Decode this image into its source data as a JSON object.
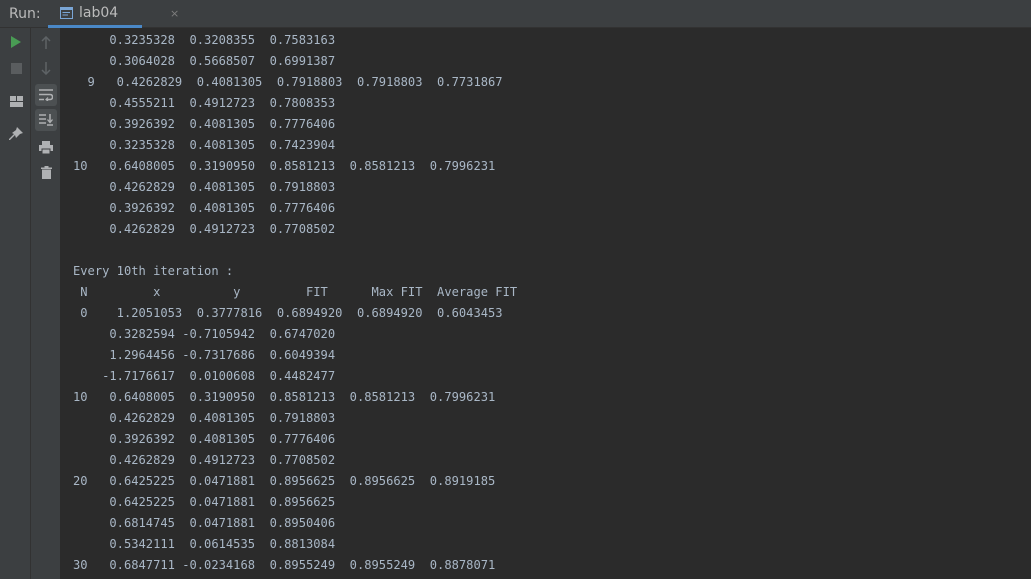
{
  "header": {
    "run_label": "Run:",
    "tab": {
      "label": "lab04",
      "icon": "console-icon",
      "close": "×"
    }
  },
  "toolbar": {
    "left": [
      {
        "name": "run-icon",
        "color": "#499c54"
      },
      {
        "name": "stop-icon",
        "color": "#5a5d5f"
      },
      {
        "name": "layout-icon",
        "color": "#afb1b3"
      },
      {
        "name": "pin-icon",
        "color": "#afb1b3"
      }
    ],
    "right": [
      {
        "name": "up-arrow-icon",
        "color": "#5e6366"
      },
      {
        "name": "down-arrow-icon",
        "color": "#5e6366"
      },
      {
        "name": "soft-wrap-icon",
        "color": "#afb1b3"
      },
      {
        "name": "scroll-to-end-icon",
        "color": "#afb1b3"
      },
      {
        "name": "print-icon",
        "color": "#afb1b3"
      },
      {
        "name": "trash-icon",
        "color": "#afb1b3"
      }
    ]
  },
  "console": {
    "lines": [
      "     0.3235328  0.3208355  0.7583163",
      "     0.3064028  0.5668507  0.6991387",
      "  9   0.4262829  0.4081305  0.7918803  0.7918803  0.7731867",
      "     0.4555211  0.4912723  0.7808353",
      "     0.3926392  0.4081305  0.7776406",
      "     0.3235328  0.4081305  0.7423904",
      "10   0.6408005  0.3190950  0.8581213  0.8581213  0.7996231",
      "     0.4262829  0.4081305  0.7918803",
      "     0.3926392  0.4081305  0.7776406",
      "     0.4262829  0.4912723  0.7708502",
      "",
      "Every 10th iteration :",
      " N         x          y         FIT      Max FIT  Average FIT",
      " 0    1.2051053  0.3777816  0.6894920  0.6894920  0.6043453",
      "     0.3282594 -0.7105942  0.6747020",
      "     1.2964456 -0.7317686  0.6049394",
      "    -1.7176617  0.0100608  0.4482477",
      "10   0.6408005  0.3190950  0.8581213  0.8581213  0.7996231",
      "     0.4262829  0.4081305  0.7918803",
      "     0.3926392  0.4081305  0.7776406",
      "     0.4262829  0.4912723  0.7708502",
      "20   0.6425225  0.0471881  0.8956625  0.8956625  0.8919185",
      "     0.6425225  0.0471881  0.8956625",
      "     0.6814745  0.0471881  0.8950406",
      "     0.5342111  0.0614535  0.8813084",
      "30   0.6847711 -0.0234168  0.8955249  0.8955249  0.8878071"
    ]
  }
}
